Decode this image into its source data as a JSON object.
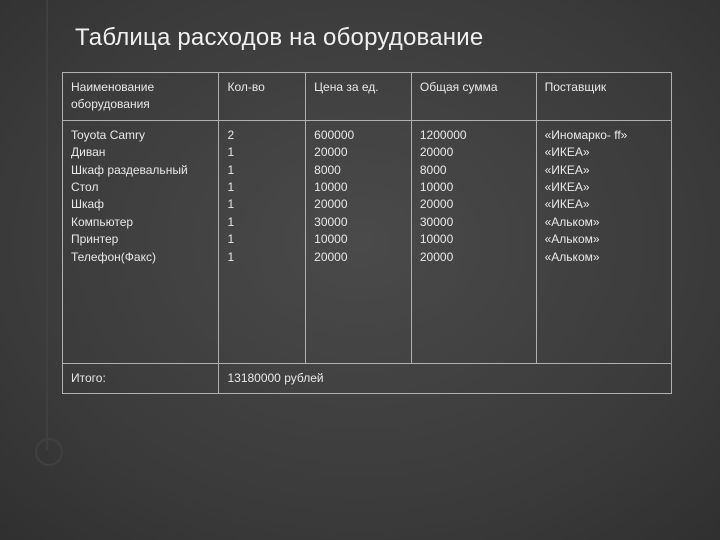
{
  "title": "Таблица расходов на оборудование",
  "headers": {
    "name": "Наименование оборудования",
    "qty": "Кол-во",
    "price": "Цена за ед.",
    "sum": "Общая сумма",
    "supplier": "Поставщик"
  },
  "rows": [
    {
      "name": "Toyota Camry",
      "qty": "2",
      "price": "600000",
      "sum": "1200000",
      "supplier": "«Иномарко- ff»"
    },
    {
      "name": "Диван",
      "qty": "1",
      "price": "20000",
      "sum": "20000",
      "supplier": "«ИКЕА»"
    },
    {
      "name": "Шкаф раздевальный",
      "qty": "1",
      "price": "8000",
      "sum": "8000",
      "supplier": "«ИКЕА»"
    },
    {
      "name": "Стол",
      "qty": "1",
      "price": "10000",
      "sum": "10000",
      "supplier": "«ИКЕА»"
    },
    {
      "name": "Шкаф",
      "qty": "1",
      "price": "20000",
      "sum": "20000",
      "supplier": "«ИКЕА»"
    },
    {
      "name": "Компьютер",
      "qty": "1",
      "price": "30000",
      "sum": "30000",
      "supplier": "«Альком»"
    },
    {
      "name": "Принтер",
      "qty": "1",
      "price": "10000",
      "sum": "10000",
      "supplier": "«Альком»"
    },
    {
      "name": "Телефон(Факс)",
      "qty": "1",
      "price": "20000",
      "sum": "20000",
      "supplier": "«Альком»"
    }
  ],
  "footer": {
    "label": "Итого:",
    "total": "13180000 рублей"
  },
  "chart_data": {
    "type": "table",
    "title": "Таблица расходов на оборудование",
    "columns": [
      "Наименование оборудования",
      "Кол-во",
      "Цена за ед.",
      "Общая сумма",
      "Поставщик"
    ],
    "rows": [
      [
        "Toyota Camry",
        2,
        600000,
        1200000,
        "«Иномарко- ff»"
      ],
      [
        "Диван",
        1,
        20000,
        20000,
        "«ИКЕА»"
      ],
      [
        "Шкаф раздевальный",
        1,
        8000,
        8000,
        "«ИКЕА»"
      ],
      [
        "Стол",
        1,
        10000,
        10000,
        "«ИКЕА»"
      ],
      [
        "Шкаф",
        1,
        20000,
        20000,
        "«ИКЕА»"
      ],
      [
        "Компьютер",
        1,
        30000,
        30000,
        "«Альком»"
      ],
      [
        "Принтер",
        1,
        10000,
        10000,
        "«Альком»"
      ],
      [
        "Телефон(Факс)",
        1,
        20000,
        20000,
        "«Альком»"
      ]
    ],
    "total_label": "Итого:",
    "total_value": 13180000,
    "total_unit": "рублей"
  }
}
